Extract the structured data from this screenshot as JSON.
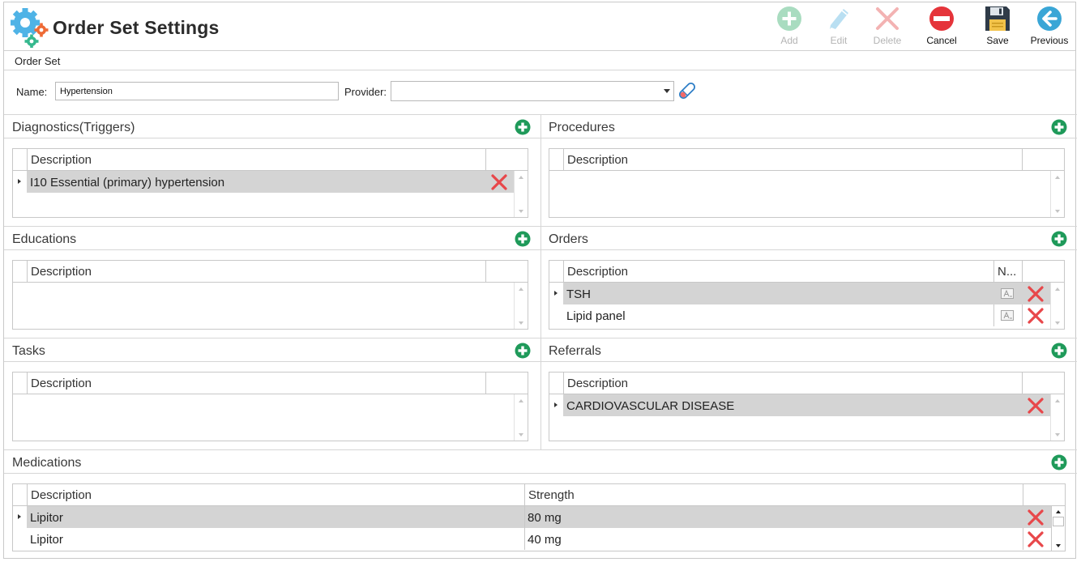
{
  "header": {
    "title": "Order Set Settings",
    "toolbar": {
      "add": "Add",
      "edit": "Edit",
      "delete": "Delete",
      "cancel": "Cancel",
      "save": "Save",
      "previous": "Previous"
    }
  },
  "order_set": {
    "section_label": "Order Set",
    "name_label": "Name:",
    "name_value": "Hypertension",
    "provider_label": "Provider:",
    "provider_value": ""
  },
  "panels": {
    "diagnostics": {
      "title": "Diagnostics(Triggers)",
      "col_description": "Description",
      "rows": [
        {
          "description": "I10 Essential (primary) hypertension"
        }
      ]
    },
    "procedures": {
      "title": "Procedures",
      "col_description": "Description",
      "rows": []
    },
    "educations": {
      "title": "Educations",
      "col_description": "Description",
      "rows": []
    },
    "orders": {
      "title": "Orders",
      "col_description": "Description",
      "col_note": "N...",
      "rows": [
        {
          "description": "TSH"
        },
        {
          "description": "Lipid panel"
        }
      ]
    },
    "tasks": {
      "title": "Tasks",
      "col_description": "Description",
      "rows": []
    },
    "referrals": {
      "title": "Referrals",
      "col_description": "Description",
      "rows": [
        {
          "description": "CARDIOVASCULAR DISEASE"
        }
      ]
    },
    "medications": {
      "title": "Medications",
      "col_description": "Description",
      "col_strength": "Strength",
      "rows": [
        {
          "description": "Lipitor",
          "strength": "80 mg"
        },
        {
          "description": "Lipitor",
          "strength": "40 mg"
        }
      ]
    }
  },
  "icons": {
    "logo": "gears-icon",
    "add": "plus-circle-icon",
    "edit": "pencil-icon",
    "delete": "x-icon",
    "cancel": "no-entry-icon",
    "save": "floppy-disk-icon",
    "previous": "arrow-left-circle-icon",
    "row_delete": "x-icon",
    "clear_provider": "eraser-icon",
    "note": "note-icon"
  },
  "colors": {
    "accent_green": "#1f9a5a",
    "delete_red": "#e8474a",
    "cancel_red": "#e5343a",
    "previous_teal": "#3aa6d6",
    "selected_row": "#d4d4d4"
  }
}
